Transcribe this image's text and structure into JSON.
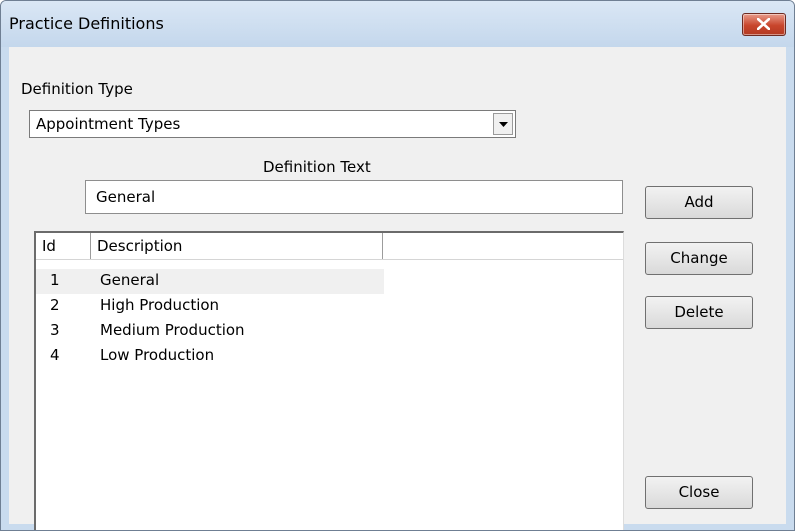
{
  "window": {
    "title": "Practice Definitions"
  },
  "definition_type": {
    "label": "Definition Type",
    "selected": "Appointment Types"
  },
  "definition_text": {
    "label": "Definition Text",
    "value": "General"
  },
  "buttons": {
    "add": "Add",
    "change": "Change",
    "delete": "Delete",
    "close": "Close"
  },
  "list": {
    "columns": [
      "Id",
      "Description",
      ""
    ],
    "rows": [
      {
        "id": "1",
        "description": "General",
        "selected": true
      },
      {
        "id": "2",
        "description": "High Production"
      },
      {
        "id": "3",
        "description": "Medium Production"
      },
      {
        "id": "4",
        "description": "Low Production"
      }
    ]
  }
}
